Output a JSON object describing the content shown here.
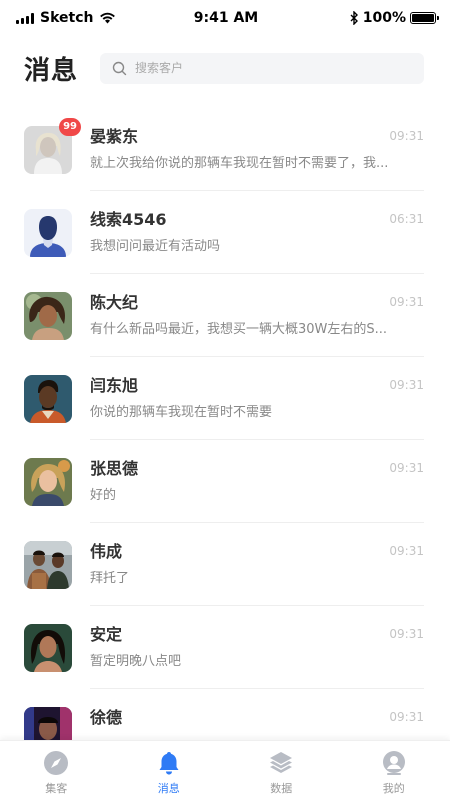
{
  "status_bar": {
    "carrier": "Sketch",
    "time": "9:41 AM",
    "battery": "100%",
    "battery_level": 1.0
  },
  "header": {
    "title": "消息",
    "search_placeholder": "搜索客户"
  },
  "colors": {
    "accent": "#2f7bf5",
    "badge": "#f04848",
    "inactive_icon": "#b8bcc4"
  },
  "conversations": [
    {
      "name": "晏紫东",
      "time": "09:31",
      "message": "就上次我给你说的那辆车我现在暂时不需要了，我...",
      "unread": "99",
      "avatar_icon": "avatar-photo-woman-blonde"
    },
    {
      "name": "线索4546",
      "time": "06:31",
      "message": "我想问问最近有活动吗",
      "unread": "",
      "avatar_icon": "avatar-placeholder-person"
    },
    {
      "name": "陈大纪",
      "time": "09:31",
      "message": "有什么新品吗最近，我想买一辆大概30W左右的S...",
      "unread": "",
      "avatar_icon": "avatar-photo-woman-curly"
    },
    {
      "name": "闫东旭",
      "time": "09:31",
      "message": "你说的那辆车我现在暂时不需要",
      "unread": "",
      "avatar_icon": "avatar-photo-man"
    },
    {
      "name": "张思德",
      "time": "09:31",
      "message": "好的",
      "unread": "",
      "avatar_icon": "avatar-photo-woman-smiling"
    },
    {
      "name": "伟成",
      "time": "09:31",
      "message": "拜托了",
      "unread": "",
      "avatar_icon": "avatar-photo-two-men"
    },
    {
      "name": "安定",
      "time": "09:31",
      "message": "暂定明晚八点吧",
      "unread": "",
      "avatar_icon": "avatar-photo-woman-dark"
    },
    {
      "name": "徐德",
      "time": "09:31",
      "message": "",
      "unread": "",
      "avatar_icon": "avatar-photo-neon"
    }
  ],
  "tabs": [
    {
      "label": "集客",
      "icon": "compass-icon",
      "active": false
    },
    {
      "label": "消息",
      "icon": "bell-icon",
      "active": true
    },
    {
      "label": "数据",
      "icon": "layers-icon",
      "active": false
    },
    {
      "label": "我的",
      "icon": "user-icon",
      "active": false
    }
  ]
}
